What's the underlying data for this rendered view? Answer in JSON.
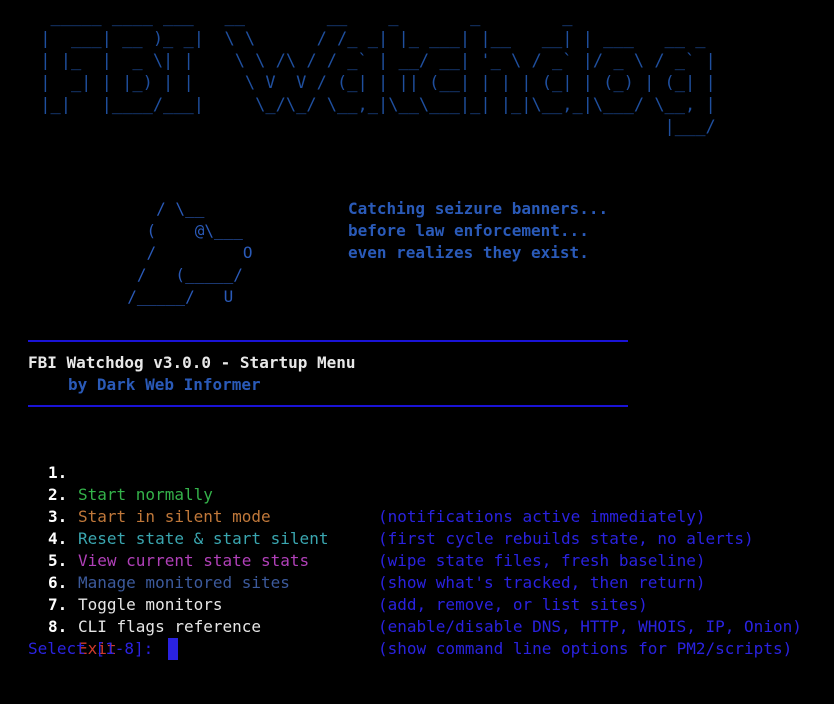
{
  "banner": {
    "ascii": "  _____ ____ ___   __        __    _       _        _\n |  ___| __ )_ _|  \\ \\      / /_ _| |_ ___| |__   __| | ___   __ _\n | |_  |  _ \\| |    \\ \\ /\\ / / _` | __/ __| '_ \\ / _` |/ _ \\ / _` |\n |  _| | |_) | |     \\ V  V / (_| | || (__| | | | (_| | (_) | (_| |\n |_|   |____/___|     \\_/\\_/ \\__,_|\\__\\___|_| |_|\\__,_|\\___/ \\__, |\n                                                              |___/"
  },
  "dog_art": "     / \\__\n    (    @\\___\n    /         O\n   /   (_____/\n  /_____/   U",
  "tagline": [
    "Catching seizure banners...",
    "before law enforcement...",
    "even realizes they exist."
  ],
  "menu": {
    "title": "FBI Watchdog v3.0.0 - Startup Menu",
    "byline": "by Dark Web Informer",
    "items": [
      {
        "num": "1.",
        "label": "Start normally",
        "desc": "(notifications active immediately)",
        "color": "#34b34a"
      },
      {
        "num": "2.",
        "label": "Start in silent mode",
        "desc": "(first cycle rebuilds state, no alerts)",
        "color": "#c0783a"
      },
      {
        "num": "3.",
        "label": "Reset state & start silent",
        "desc": "(wipe state files, fresh baseline)",
        "color": "#3aa6b0"
      },
      {
        "num": "4.",
        "label": "View current state stats",
        "desc": "(show what's tracked, then return)",
        "color": "#b040b8"
      },
      {
        "num": "5.",
        "label": "Manage monitored sites",
        "desc": "(add, remove, or list sites)",
        "color": "#3c5a9c"
      },
      {
        "num": "6.",
        "label": "Toggle monitors",
        "desc": "(enable/disable DNS, HTTP, WHOIS, IP, Onion)",
        "color": "#e6e6e6"
      },
      {
        "num": "7.",
        "label": "CLI flags reference",
        "desc": "(show command line options for PM2/scripts)",
        "color": "#e6e6e6"
      },
      {
        "num": "8.",
        "label": "Exit",
        "desc": "",
        "color": "#d03a2a"
      }
    ]
  },
  "prompt": {
    "text": "Select [1-8]: "
  },
  "colors": {
    "background": "#000000",
    "banner": "#1f4f9e",
    "accent_blue": "#2a5ab8",
    "rule_blue": "#1a13d6",
    "desc_blue": "#2a22e0"
  }
}
